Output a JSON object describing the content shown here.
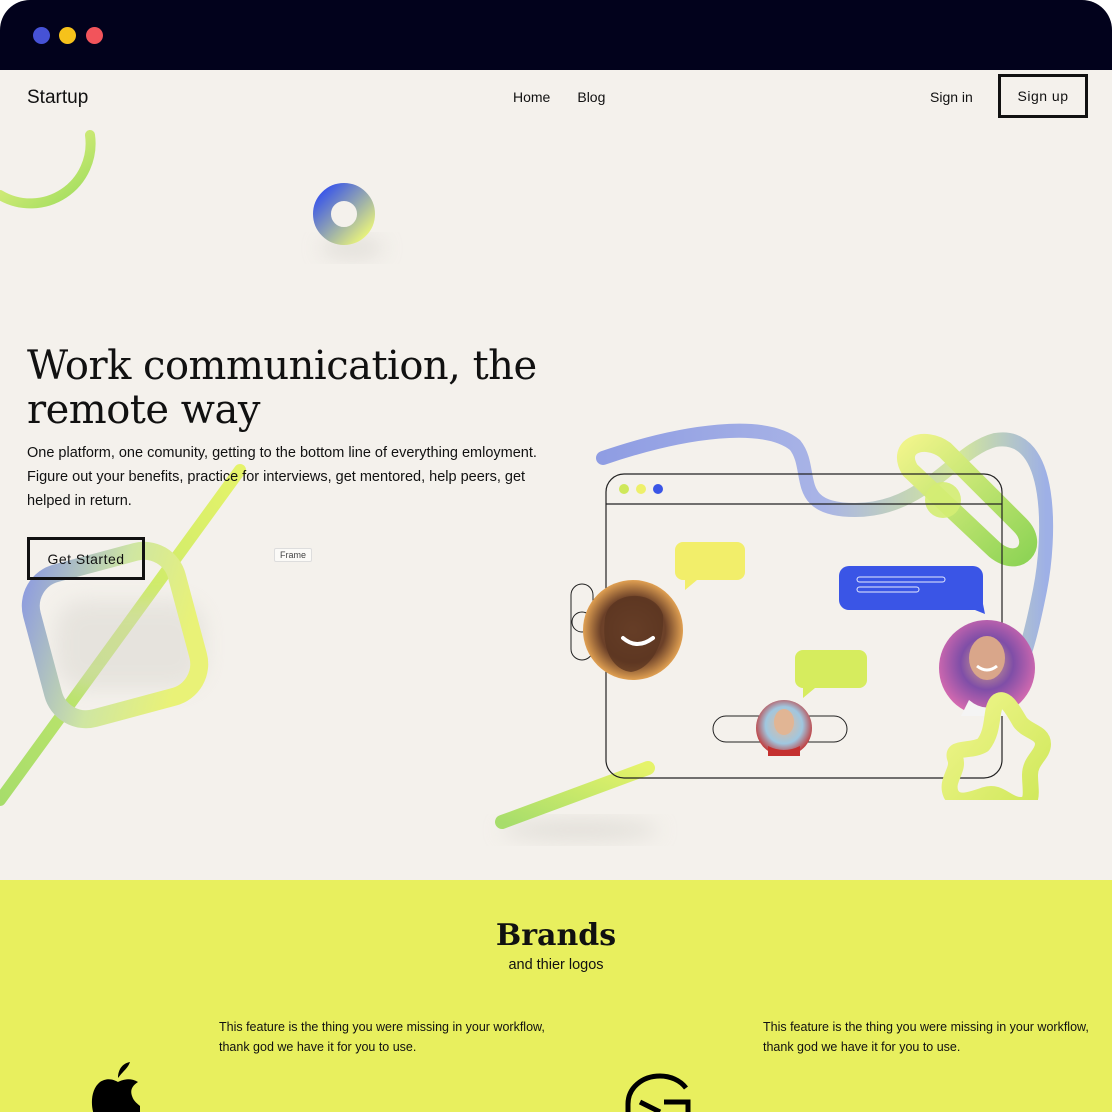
{
  "window": {
    "controls": [
      "window-dot-blue",
      "window-dot-yellow",
      "window-dot-red"
    ]
  },
  "nav": {
    "logo": "Startup",
    "links": [
      "Home",
      "Blog"
    ],
    "signin": "Sign in",
    "signup": "Sign up"
  },
  "hero": {
    "headline": "Work communication, the remote way",
    "subcopy": "One platform, one comunity, getting to the bottom line of everything emloyment. Figure out your benefits, practice for interviews, get mentored, help peers, get helped in return.",
    "cta": "Get Started",
    "frame_tag": "Frame"
  },
  "brands": {
    "title": "Brands",
    "subtitle": "and thier logos",
    "features": [
      {
        "text": "This feature is the thing you were missing in your workflow, thank god we have it for you to use.",
        "logo": "apple-logo-icon"
      },
      {
        "text": "This feature is the thing you were missing in your workflow, thank god we have it for you to use.",
        "logo": "g-logo-icon"
      }
    ]
  },
  "colors": {
    "titlebar": "#02021c",
    "hero_bg": "#f4f1ec",
    "brands_bg": "#e8ef5e",
    "accent_blue": "#3a55e6",
    "accent_lime": "#d6ec5e",
    "accent_yellow": "#f2ee6a"
  }
}
